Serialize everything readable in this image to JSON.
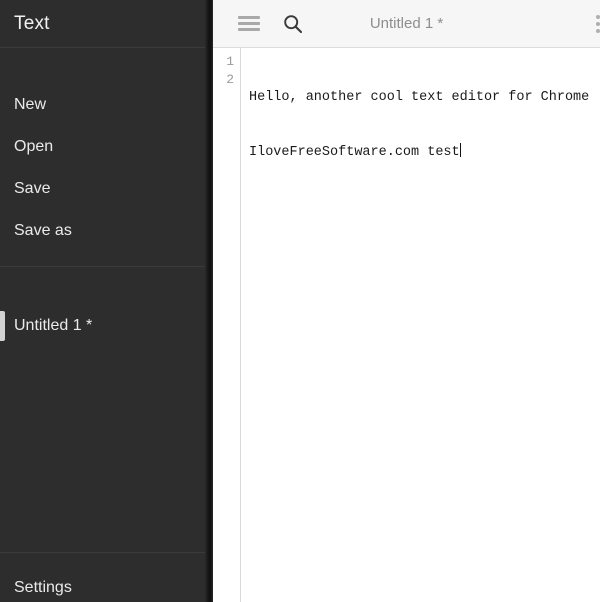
{
  "sidebar": {
    "app_title": "Text",
    "actions": [
      {
        "label": "New",
        "name": "sidebar-item-new"
      },
      {
        "label": "Open",
        "name": "sidebar-item-open"
      },
      {
        "label": "Save",
        "name": "sidebar-item-save"
      },
      {
        "label": "Save as",
        "name": "sidebar-item-save-as"
      }
    ],
    "files": [
      {
        "label": "Untitled 1 *",
        "active": true
      }
    ],
    "settings_label": "Settings"
  },
  "toolbar": {
    "menu_icon": "hamburger-menu-icon",
    "search_icon": "search-icon",
    "overflow_icon": "more-vertical-icon",
    "title": "Untitled 1 *"
  },
  "editor": {
    "line_numbers": [
      "1",
      "2"
    ],
    "lines": [
      "Hello, another cool text editor for Chrome",
      "IloveFreeSoftware.com test"
    ]
  },
  "colors": {
    "sidebar_bg": "#2d2d2d",
    "sidebar_divider": "#3b3b3b",
    "sidebar_text": "#eaeaea",
    "active_indicator": "#d2d2d2",
    "gutter_strip": "#141414",
    "toolbar_bg": "#f6f6f6",
    "toolbar_border": "#dcdcdc",
    "toolbar_title": "#8e8e8e",
    "icon_gray": "#a9a9a9",
    "code_text": "#1b1b1b",
    "line_number": "#9b9b9b"
  }
}
